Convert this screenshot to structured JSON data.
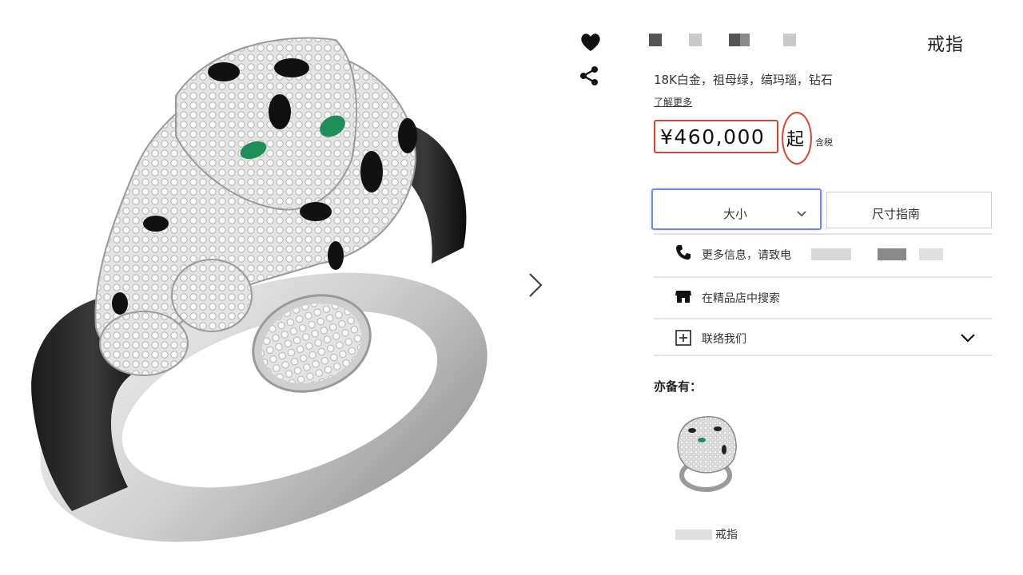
{
  "product": {
    "title": "戒指",
    "materials": "18K白金，祖母绿，缟玛瑙，钻石",
    "learn_more": "了解更多",
    "price": "¥460,000",
    "price_suffix": "起",
    "tax_note": "含税"
  },
  "options": {
    "size_label": "大小",
    "size_guide_label": "尺寸指南"
  },
  "contact": {
    "phone_text": "更多信息，请致电",
    "store_search_text": "在精品店中搜索",
    "contact_us_text": "联络我们"
  },
  "also_available": {
    "heading": "亦备有：",
    "items": [
      {
        "name": "戒指"
      }
    ]
  },
  "colors": {
    "highlight_red": "#d9432b",
    "select_border_blue": "#6f8ddc",
    "emerald": "#1f8f5a"
  },
  "icons": [
    "heart-icon",
    "share-icon",
    "chevron-right-icon",
    "chevron-down-icon",
    "phone-icon",
    "store-icon",
    "plus-square-icon"
  ]
}
